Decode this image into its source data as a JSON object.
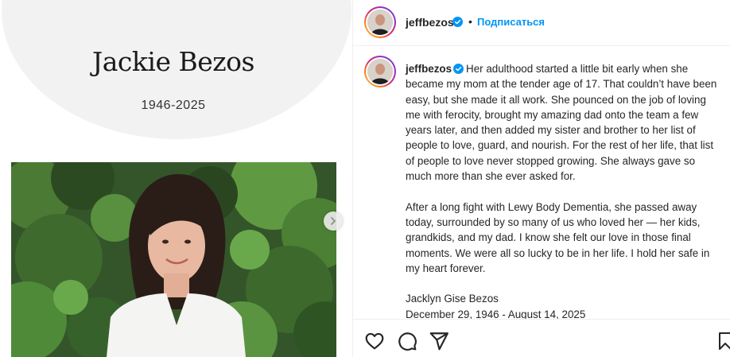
{
  "memorial": {
    "name": "Jackie Bezos",
    "years": "1946-2025"
  },
  "post": {
    "username": "jeffbezos",
    "verified": true,
    "separator": "•",
    "follow_label": "Подписаться",
    "caption_paragraphs": [
      "Her adulthood started a little bit early when she became my mom at the tender age of 17. That couldn’t have been easy, but she made it all work. She pounced on the job of loving me with ferocity, brought my amazing dad onto the team a few years later, and then added my sister and brother to her list of people to love, guard, and nourish. For the rest of her life, that list of people to love never stopped growing. She always gave so much more than she ever asked for.",
      "After a long fight with Lewy Body Dementia, she passed away today, surrounded by so many of us who loved her — her kids, grandkids, and my dad. I know she felt our love in those final moments. We were all so lucky to be in her life. I hold her safe in my heart forever."
    ],
    "signature_name": "Jacklyn Gise Bezos",
    "signature_dates": "December 29, 1946 - August 14, 2025"
  },
  "icons": {
    "like": "heart-icon",
    "comment": "comment-icon",
    "share": "paper-plane-icon",
    "save": "bookmark-icon",
    "next": "chevron-right-icon",
    "verified": "verified-badge-icon"
  },
  "colors": {
    "link_blue": "#0095f6",
    "verified_blue": "#0095f6",
    "text": "#262626",
    "memorial_bg": "#f2f2f2"
  }
}
